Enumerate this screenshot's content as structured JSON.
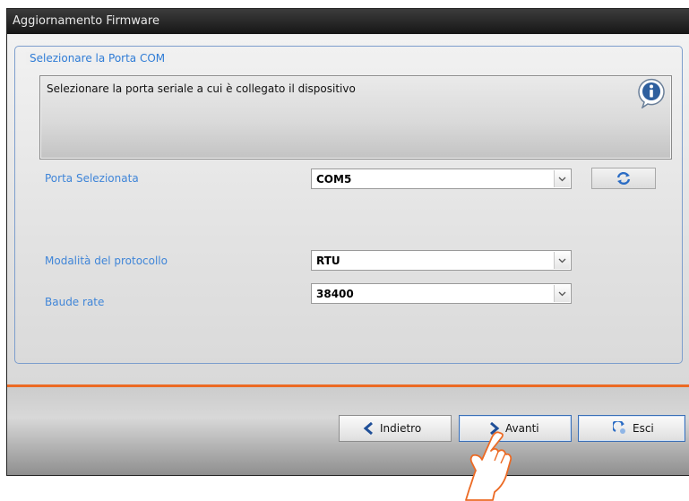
{
  "window": {
    "title": "Aggiornamento Firmware"
  },
  "group": {
    "title": "Selezionare la Porta COM"
  },
  "info": {
    "text": "Selezionare la porta seriale a cui è collegato il dispositivo"
  },
  "fields": {
    "port": {
      "label": "Porta Selezionata",
      "value": "COM5"
    },
    "protocol": {
      "label": "Modalità del protocollo",
      "value": "RTU"
    },
    "baud": {
      "label": "Baude rate",
      "value": "38400"
    }
  },
  "buttons": {
    "back": "Indietro",
    "next": "Avanti",
    "exit": "Esci"
  },
  "colors": {
    "accent_line": "#ec6a24",
    "label_blue": "#3f85d8",
    "title_bar": "#222222"
  },
  "icons": {
    "info": "info-icon",
    "refresh": "refresh-icon",
    "back": "arrow-left-icon",
    "next": "arrow-right-icon",
    "exit": "exit-icon",
    "pointer": "hand-pointer-icon"
  }
}
